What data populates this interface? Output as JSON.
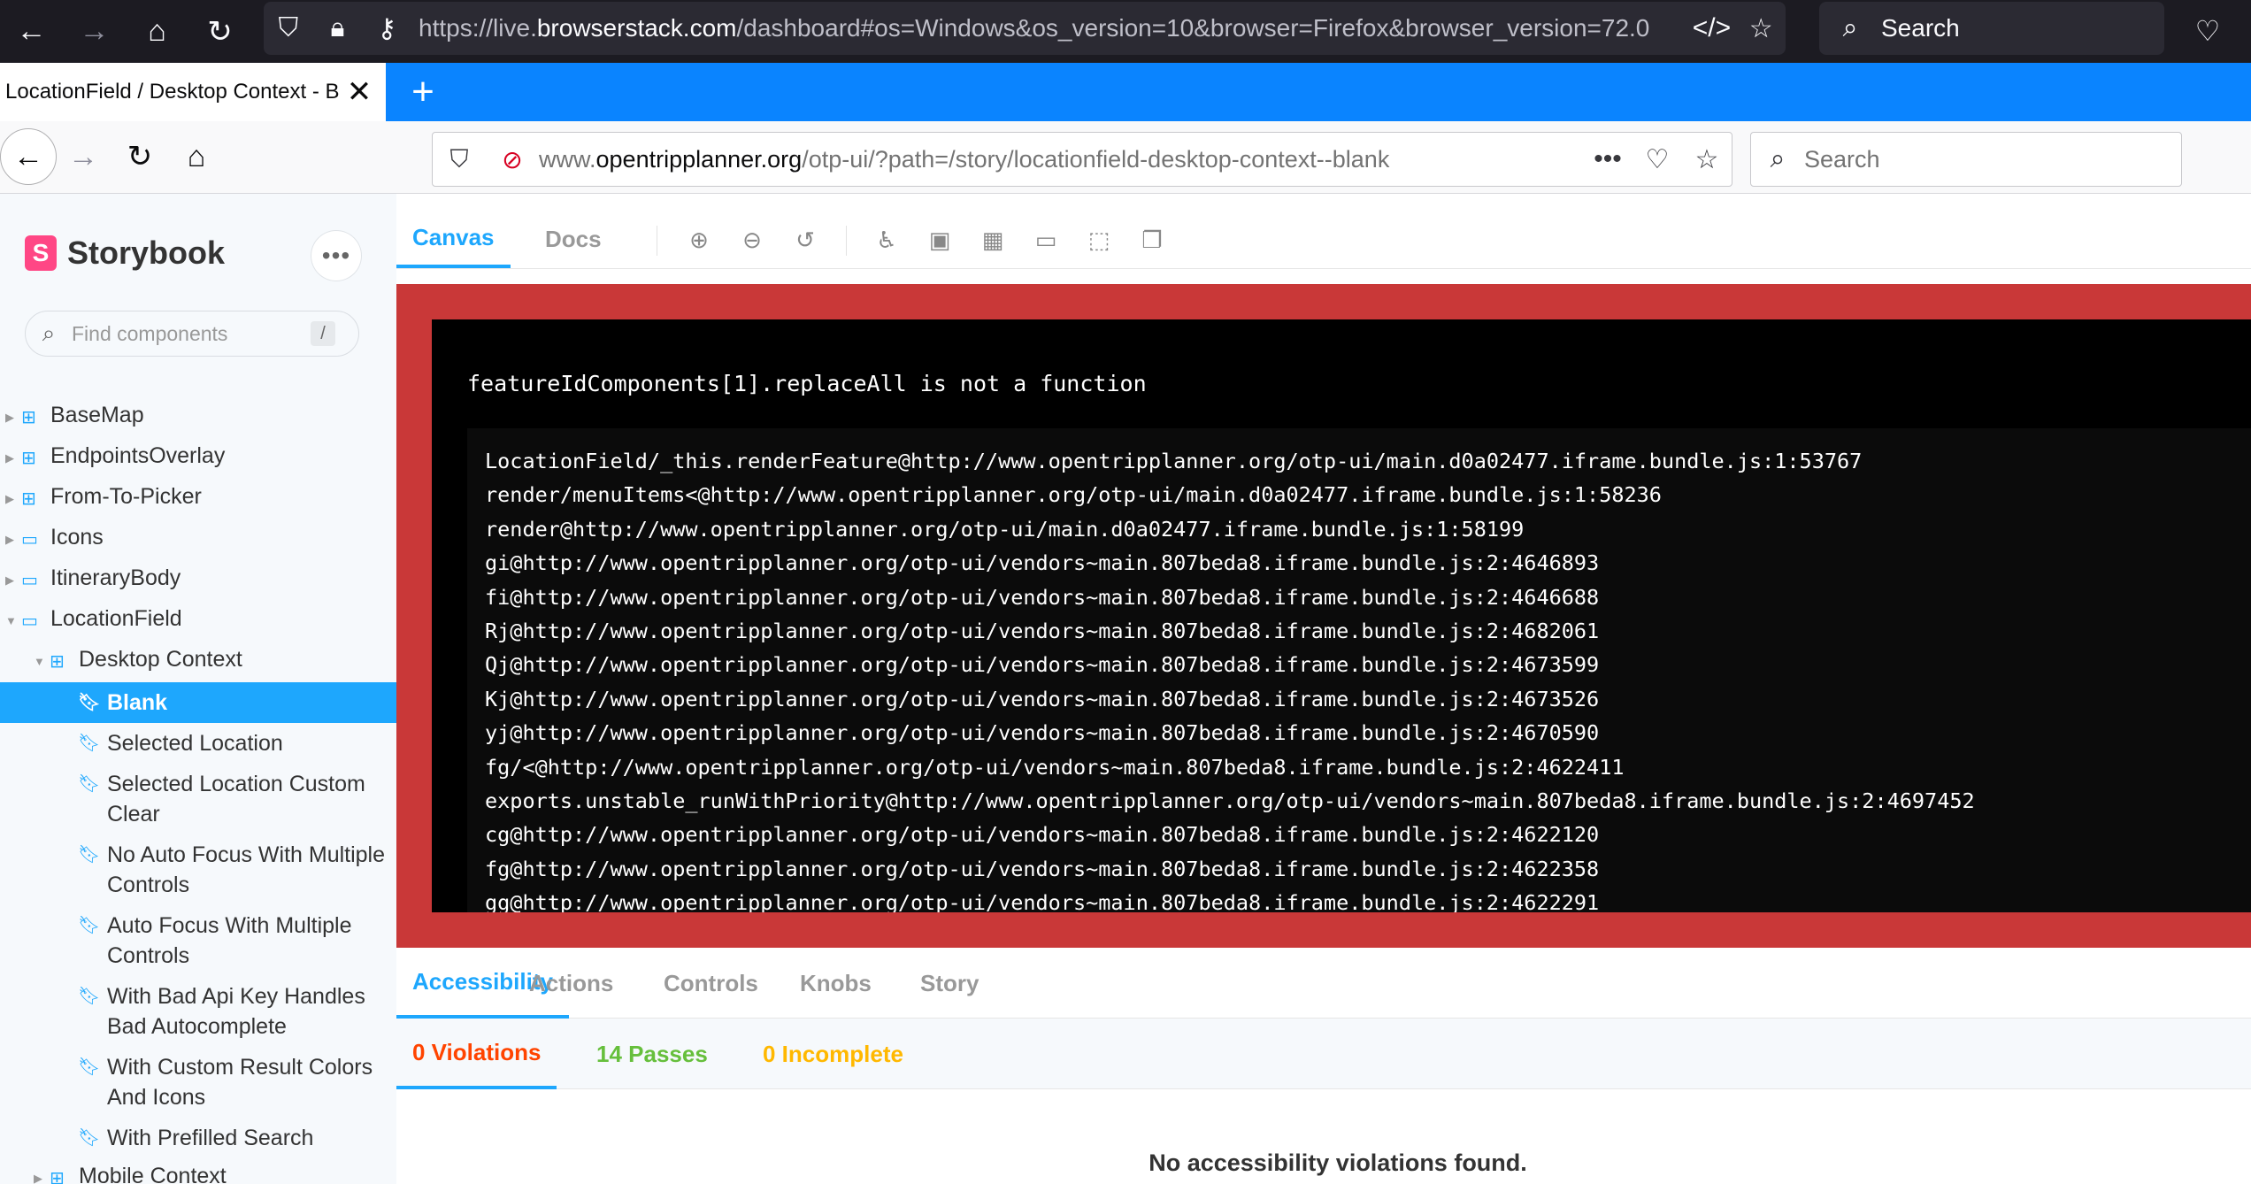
{
  "host_browser": {
    "url_prefix": "https://live.",
    "url_domain": "browserstack.com",
    "url_rest": "/dashboard#os=Windows&os_version=10&browser=Firefox&browser_version=72.0",
    "search_placeholder": "Search"
  },
  "remote_browser": {
    "tab_title": "LocationField / Desktop Context - B",
    "url_prefix": "www.",
    "url_domain": "opentripplanner.org",
    "url_rest": "/otp-ui/?path=/story/locationfield-desktop-context--blank",
    "search_placeholder": "Search"
  },
  "sidebar": {
    "brand": "Storybook",
    "search_placeholder": "Find components",
    "search_shortcut": "/",
    "tree": [
      {
        "label": "BaseMap",
        "type": "component",
        "level": 0
      },
      {
        "label": "EndpointsOverlay",
        "type": "component",
        "level": 0
      },
      {
        "label": "From-To-Picker",
        "type": "component",
        "level": 0
      },
      {
        "label": "Icons",
        "type": "folder",
        "level": 0
      },
      {
        "label": "ItineraryBody",
        "type": "folder",
        "level": 0
      },
      {
        "label": "LocationField",
        "type": "folder",
        "level": 0,
        "expanded": true
      },
      {
        "label": "Desktop Context",
        "type": "component",
        "level": 1,
        "expanded": true
      },
      {
        "label": "Blank",
        "type": "story",
        "level": 2,
        "selected": true
      },
      {
        "label": "Selected Location",
        "type": "story",
        "level": 2
      },
      {
        "label": "Selected Location Custom Clear",
        "type": "story",
        "level": 2
      },
      {
        "label": "No Auto Focus With Multiple Controls",
        "type": "story",
        "level": 2
      },
      {
        "label": "Auto Focus With Multiple Controls",
        "type": "story",
        "level": 2
      },
      {
        "label": "With Bad Api Key Handles Bad Autocomplete",
        "type": "story",
        "level": 2
      },
      {
        "label": "With Custom Result Colors And Icons",
        "type": "story",
        "level": 2
      },
      {
        "label": "With Prefilled Search",
        "type": "story",
        "level": 2
      },
      {
        "label": "Mobile Context",
        "type": "component",
        "level": 1
      }
    ]
  },
  "toolbar": {
    "tabs": [
      "Canvas",
      "Docs"
    ],
    "active_tab": "Canvas"
  },
  "error": {
    "message": "featureIdComponents[1].replaceAll is not a function",
    "stack": [
      "LocationField/_this.renderFeature@http://www.opentripplanner.org/otp-ui/main.d0a02477.iframe.bundle.js:1:53767",
      "render/menuItems<@http://www.opentripplanner.org/otp-ui/main.d0a02477.iframe.bundle.js:1:58236",
      "render@http://www.opentripplanner.org/otp-ui/main.d0a02477.iframe.bundle.js:1:58199",
      "gi@http://www.opentripplanner.org/otp-ui/vendors~main.807beda8.iframe.bundle.js:2:4646893",
      "fi@http://www.opentripplanner.org/otp-ui/vendors~main.807beda8.iframe.bundle.js:2:4646688",
      "Rj@http://www.opentripplanner.org/otp-ui/vendors~main.807beda8.iframe.bundle.js:2:4682061",
      "Qj@http://www.opentripplanner.org/otp-ui/vendors~main.807beda8.iframe.bundle.js:2:4673599",
      "Kj@http://www.opentripplanner.org/otp-ui/vendors~main.807beda8.iframe.bundle.js:2:4673526",
      "yj@http://www.opentripplanner.org/otp-ui/vendors~main.807beda8.iframe.bundle.js:2:4670590",
      "fg/<@http://www.opentripplanner.org/otp-ui/vendors~main.807beda8.iframe.bundle.js:2:4622411",
      "exports.unstable_runWithPriority@http://www.opentripplanner.org/otp-ui/vendors~main.807beda8.iframe.bundle.js:2:4697452",
      "cg@http://www.opentripplanner.org/otp-ui/vendors~main.807beda8.iframe.bundle.js:2:4622120",
      "fg@http://www.opentripplanner.org/otp-ui/vendors~main.807beda8.iframe.bundle.js:2:4622358",
      "gg@http://www.opentripplanner.org/otp-ui/vendors~main.807beda8.iframe.bundle.js:2:4622291"
    ]
  },
  "addons": {
    "tabs": [
      "Accessibility",
      "Actions",
      "Controls",
      "Knobs",
      "Story"
    ],
    "active_tab": "Accessibility",
    "a11y": {
      "violations_label": "0 Violations",
      "passes_label": "14 Passes",
      "incomplete_label": "0 Incomplete",
      "empty_message": "No accessibility violations found."
    }
  },
  "colors": {
    "accent": "#1ea7fd",
    "error_bg": "#c93838",
    "storybook_pink": "#ff4785",
    "violations": "#ff4400",
    "passes": "#66bf3c",
    "incomplete": "#ffb800"
  }
}
